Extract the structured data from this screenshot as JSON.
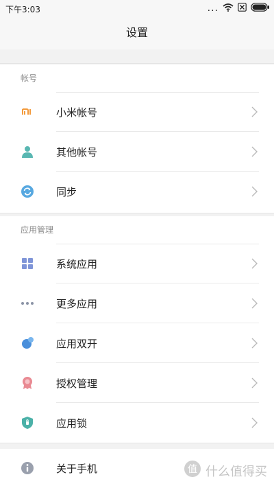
{
  "status_bar": {
    "time": "下午3:03",
    "more": "...",
    "icons": [
      "wifi-icon",
      "no-sim-icon",
      "battery-icon"
    ]
  },
  "header": {
    "title": "设置"
  },
  "sections": [
    {
      "title": "帐号",
      "items": [
        {
          "label": "小米帐号",
          "icon": "mi-logo-icon"
        },
        {
          "label": "其他帐号",
          "icon": "person-icon"
        },
        {
          "label": "同步",
          "icon": "sync-icon"
        }
      ]
    },
    {
      "title": "应用管理",
      "items": [
        {
          "label": "系统应用",
          "icon": "grid-icon"
        },
        {
          "label": "更多应用",
          "icon": "more-dots-icon"
        },
        {
          "label": "应用双开",
          "icon": "dual-app-icon"
        },
        {
          "label": "授权管理",
          "icon": "badge-icon"
        },
        {
          "label": "应用锁",
          "icon": "shield-lock-icon"
        }
      ]
    },
    {
      "title": "",
      "items": [
        {
          "label": "关于手机",
          "icon": "info-icon"
        }
      ]
    }
  ],
  "watermark": {
    "text": "什么值得买",
    "logo": "值"
  },
  "colors": {
    "mi": "#f39a3b",
    "person": "#59b7b2",
    "sync": "#57a8e0",
    "grid": "#7f95d8",
    "dots": "#8b93a6",
    "dual": "#4a8fdb",
    "badge": "#e98a93",
    "shield": "#4bb1a8",
    "info": "#9aa0ad"
  }
}
